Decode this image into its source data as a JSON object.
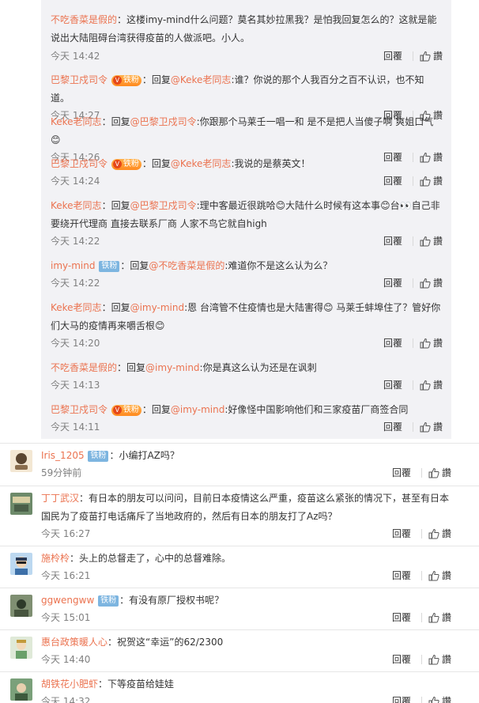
{
  "replies": [
    {
      "user": "不吃香菜是假的",
      "badge": null,
      "sep": "：",
      "text_line": "这楼imy-mind什么问题？莫名其妙拉黑我？是怕我回复怎么的？这就是能说出大陆阻碍台湾获得疫苗的人做派吧。小人。",
      "time": "今天 14:42"
    },
    {
      "user": "巴黎卫戍司令",
      "badge": "铁粉",
      "badge_type": "vip",
      "sep": "：",
      "prefix": "回复",
      "mention": "@Keke老同志",
      "text_line": ":谁？你说的那个人我百分之百不认识，也不知道。",
      "time": "今天 14:27"
    },
    {
      "user": "Keke老同志",
      "badge": null,
      "sep": "：",
      "prefix": "回复",
      "mention": "@巴黎卫戍司令",
      "text_line": ":你跟那个马莱壬一唱一和 是不是把人当傻子啊 爽姐口气😊",
      "time": "今天 14:26"
    },
    {
      "user": "巴黎卫戍司令",
      "badge": "铁粉",
      "badge_type": "vip",
      "sep": "：",
      "prefix": "回复",
      "mention": "@Keke老同志",
      "text_line": ":我说的是蔡英文！",
      "time": "今天 14:24"
    },
    {
      "user": "Keke老同志",
      "badge": null,
      "sep": "：",
      "prefix": "回复",
      "mention": "@巴黎卫戍司令",
      "text_line": ":理中客最近很跳哈😊大陆什么时候有这本事😊台👀自己非要绕开代理商 直接去联系厂商 人家不鸟它就自high",
      "time": "今天 14:22"
    },
    {
      "user": "imy-mind",
      "badge": "铁粉",
      "badge_type": "fan",
      "sep": "：",
      "prefix": "回复",
      "mention": "@不吃香菜是假的",
      "text_line": ":难道你不是这么认为么？",
      "time": "今天 14:22"
    },
    {
      "user": "Keke老同志",
      "badge": null,
      "sep": "：",
      "prefix": "回复",
      "mention": "@imy-mind",
      "text_line": ":恩 台湾管不住疫情也是大陆害得😊 马莱壬蚌埠住了？管好你们大马的疫情再来嚼舌根😊",
      "time": "今天 14:20"
    },
    {
      "user": "不吃香菜是假的",
      "badge": null,
      "sep": "：",
      "prefix": "回复",
      "mention": "@imy-mind",
      "text_line": ":你是真这么认为还是在讽刺",
      "time": "今天 14:13"
    },
    {
      "user": "巴黎卫戍司令",
      "badge": "铁粉",
      "badge_type": "vip",
      "sep": "：",
      "prefix": "回复",
      "mention": "@imy-mind",
      "text_line": ":好像怪中国影响他们和三家疫苗厂商签合同",
      "time": "今天 14:11"
    }
  ],
  "comments": [
    {
      "user": "Iris_1205",
      "badge": "铁粉",
      "sep": "：",
      "text_line": "小编打AZ吗？",
      "time": "59分钟前",
      "avatar_color": "#f3e7d3",
      "avatar_fg": "#5a4530"
    },
    {
      "user": "丁丁武汉",
      "badge": null,
      "sep": "：",
      "text_line": "有日本的朋友可以问问，目前日本疫情这么严重，疫苗这么紧张的情况下，甚至有日本国民为了疫苗打电话痛斥了当地政府的，然后有日本的朋友打了Az吗？",
      "time": "今天 16:27",
      "avatar_color": "#6d8a6a",
      "avatar_fg": "#d8cfa3"
    },
    {
      "user": "施柃柃",
      "badge": null,
      "sep": "：",
      "text_line": "头上的总督走了，心中的总督难除。",
      "time": "今天 16:21",
      "avatar_color": "#bcd8f0",
      "avatar_fg": "#2a3a55"
    },
    {
      "user": "ggwengww",
      "badge": "铁粉",
      "sep": "：",
      "text_line": "有没有原厂授权书呢？",
      "time": "今天 15:01",
      "avatar_color": "#7f8f72",
      "avatar_fg": "#2e3a2a"
    },
    {
      "user": "惠台政策暖人心",
      "badge": null,
      "sep": "：",
      "text_line": "祝贺这“幸运”的62/2300",
      "time": "今天 14:40",
      "avatar_color": "#dfe9d8",
      "avatar_fg": "#c29a3a"
    },
    {
      "user": "胡铁花小肥虾",
      "badge": null,
      "sep": "：",
      "text_line": "下等疫苗给娃娃",
      "time": "今天 14:32",
      "avatar_color": "#7aa07a",
      "avatar_fg": "#3d5a3d"
    }
  ],
  "labels": {
    "reply": "回覆",
    "like": "讚"
  }
}
